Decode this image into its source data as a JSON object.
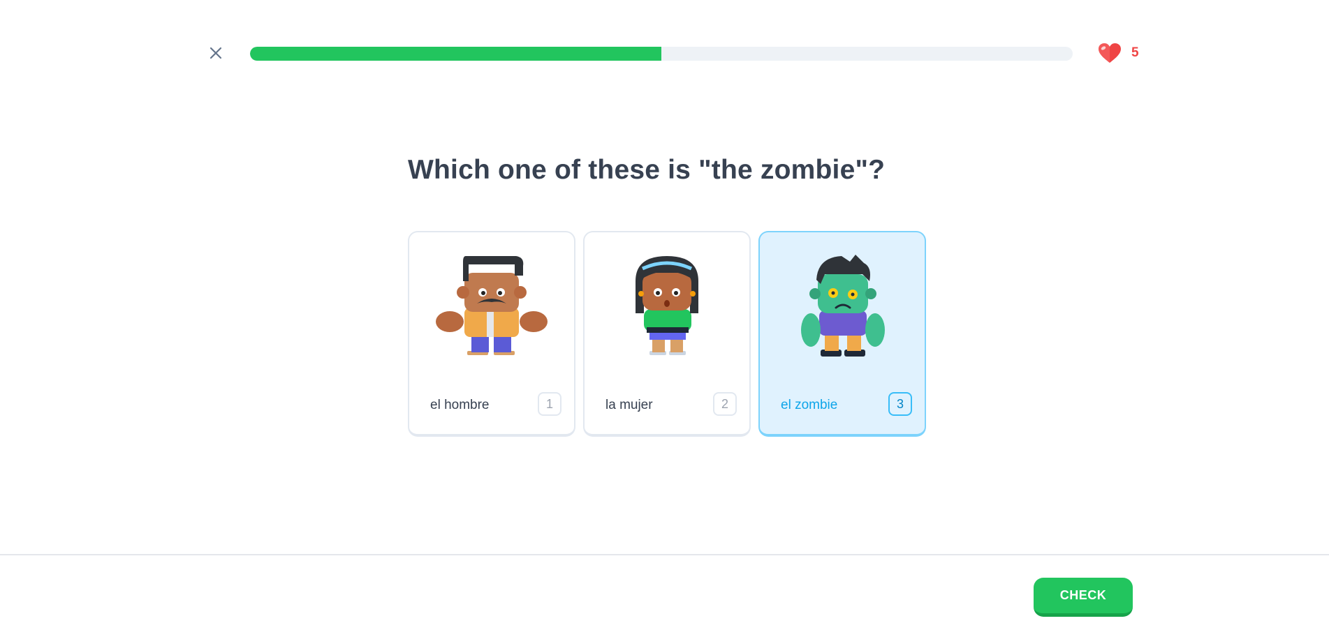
{
  "header": {
    "close_icon": "close-icon",
    "progress": 0.5,
    "progress_color": "#22c55e",
    "hearts": {
      "icon": "heart-icon",
      "count": "5",
      "color": "#ef4444"
    }
  },
  "question": {
    "text": "Which one of these is \"the zombie\"?"
  },
  "choices": [
    {
      "label": "el hombre",
      "key": "1",
      "image": "man-illustration",
      "selected": false
    },
    {
      "label": "la mujer",
      "key": "2",
      "image": "woman-illustration",
      "selected": false
    },
    {
      "label": "el zombie",
      "key": "3",
      "image": "zombie-illustration",
      "selected": true
    }
  ],
  "footer": {
    "check_label": "CHECK",
    "check_color": "#22c55e"
  }
}
